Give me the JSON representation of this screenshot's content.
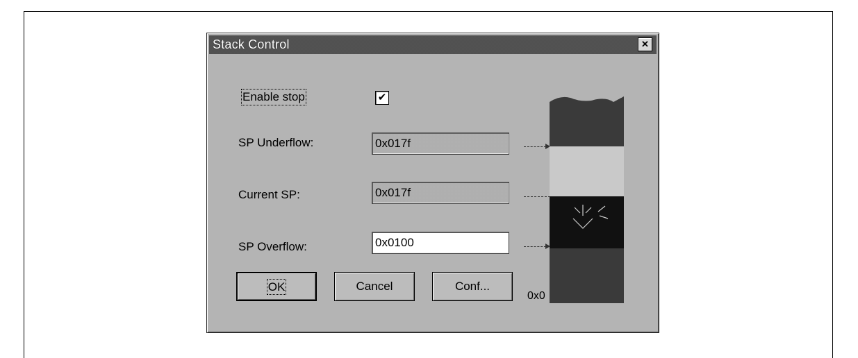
{
  "window": {
    "title": "Stack Control",
    "close_glyph": "✕"
  },
  "fields": {
    "enable_stop": {
      "label": "Enable stop",
      "checked": true,
      "check_glyph": "✔"
    },
    "sp_underflow": {
      "label": "SP Underflow:",
      "value": "0x017f"
    },
    "current_sp": {
      "label": "Current SP:",
      "value": "0x017f"
    },
    "sp_overflow": {
      "label": "SP Overflow:",
      "value": "0x0100"
    }
  },
  "buttons": {
    "ok": "OK",
    "cancel": "Cancel",
    "conf": "Conf..."
  },
  "stack_diagram": {
    "address_label": "0x0"
  },
  "colors": {
    "stack_dark": "#3a3a3a",
    "stack_light": "#c9c9c9",
    "stack_black": "#111111"
  },
  "icons": {
    "close": "close-icon",
    "checkbox": "checkmark-icon"
  }
}
